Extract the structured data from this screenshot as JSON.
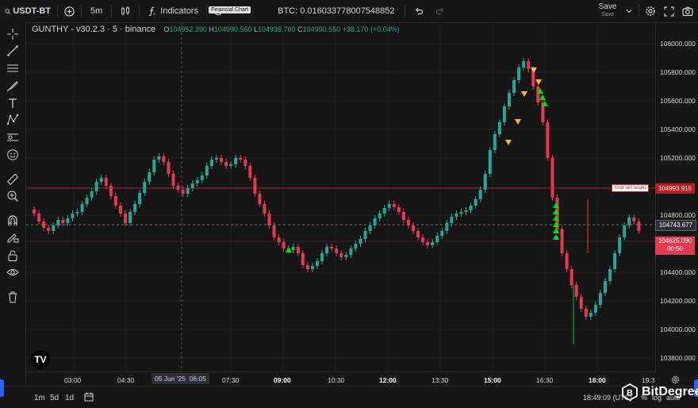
{
  "topbar": {
    "symbol": "USDT-BT",
    "interval": "5m",
    "indicators_label": "Indicators",
    "alerts_label": "Alerts",
    "tooltip": "Financial Chart",
    "btc_value": "BTC: 0.016033778007548852",
    "save_label": "Save",
    "save_sublabel": "Save"
  },
  "legend": {
    "title": "GUNTHY - v30.2.3 · 5 · binance",
    "open_label": "O",
    "open": "104952.390",
    "high_label": "H",
    "high": "104990.560",
    "low_label": "L",
    "low": "104938.760",
    "close_label": "C",
    "close": "104990.550",
    "change": "+38.170 (+0.04%)"
  },
  "price_axis": {
    "labels": [
      "106000.000",
      "105800.000",
      "105600.000",
      "105400.000",
      "105200.000",
      "104800.000",
      "104400.000",
      "104200.000",
      "104000.000",
      "103800.000"
    ],
    "grid_sell_target_label": "Grid sell target",
    "grid_sell_target": "104993.915",
    "current_price": "104743.677",
    "last_price": "104625.090",
    "countdown": "00:50"
  },
  "time_axis": {
    "labels": [
      "03:00",
      "04:30",
      "07:30",
      "09:00",
      "10:30",
      "12:00",
      "13:30",
      "15:00",
      "16:30",
      "18:00",
      "19:3"
    ],
    "crosshair_date": "05 Jun '25",
    "crosshair_time": "06:05"
  },
  "bottombar": {
    "ranges": [
      "1m",
      "5d",
      "1d"
    ],
    "clock": "18:49:09 (UTC)",
    "pct": "%",
    "log": "log",
    "auto": "auto"
  },
  "brand": {
    "name": "BitDegree",
    "watermark": "TV"
  },
  "colors": {
    "up": "#26a69a",
    "up_bright": "#00c853",
    "down": "#e53950",
    "target_line": "#b71c1c",
    "sell_marker": "#f6b93b",
    "buy_marker": "#00e400"
  }
}
